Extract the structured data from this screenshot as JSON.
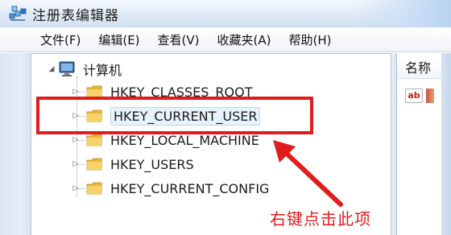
{
  "window": {
    "title": "注册表编辑器",
    "icon": "regedit-icon"
  },
  "menu": {
    "items": [
      {
        "label": "文件(F)"
      },
      {
        "label": "编辑(E)"
      },
      {
        "label": "查看(V)"
      },
      {
        "label": "收藏夹(A)"
      },
      {
        "label": "帮助(H)"
      }
    ]
  },
  "tree": {
    "root": {
      "label": "计算机",
      "icon": "computer-icon",
      "expanded": true
    },
    "keys": [
      {
        "label": "HKEY_CLASSES_ROOT",
        "icon": "folder-icon",
        "expanded": false
      },
      {
        "label": "HKEY_CURRENT_USER",
        "icon": "folder-icon",
        "expanded": false,
        "selected": true
      },
      {
        "label": "HKEY_LOCAL_MACHINE",
        "icon": "folder-icon",
        "expanded": false
      },
      {
        "label": "HKEY_USERS",
        "icon": "folder-icon",
        "expanded": false
      },
      {
        "label": "HKEY_CURRENT_CONFIG",
        "icon": "folder-icon",
        "expanded": false
      }
    ]
  },
  "list": {
    "column_header": "名称",
    "value_icon": "ab"
  },
  "annotation": {
    "text": "右键点击此项",
    "color": "#e01c1c"
  },
  "colors": {
    "accent_red": "#e01c1c",
    "folder_yellow": "#f2c94c",
    "selection": "#e8f2fc"
  }
}
